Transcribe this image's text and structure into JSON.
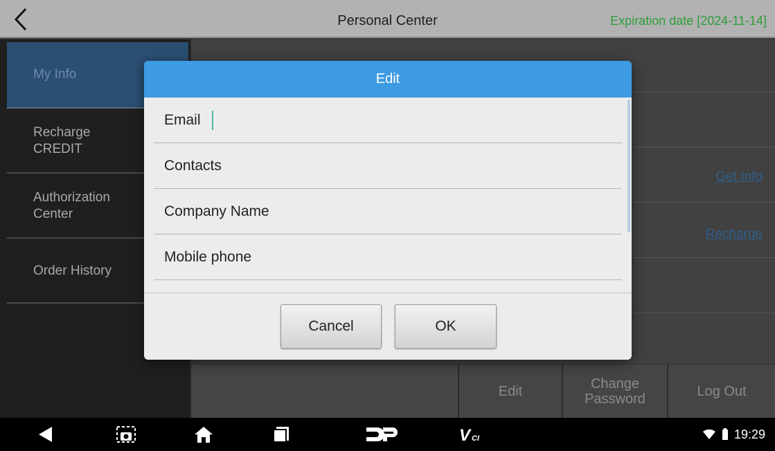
{
  "titlebar": {
    "title": "Personal Center",
    "expiry": "Expiration date [2024-11-14]"
  },
  "sidebar": {
    "items": [
      {
        "label": "My Info"
      },
      {
        "label": "Recharge\nCREDIT"
      },
      {
        "label": "Authorization\nCenter"
      },
      {
        "label": "Order History"
      }
    ]
  },
  "main": {
    "links": {
      "get_info": "Get Info",
      "recharge": "Recharge"
    }
  },
  "actions": {
    "edit": "Edit",
    "change_password": "Change\nPassword",
    "logout": "Log Out"
  },
  "dialog": {
    "title": "Edit",
    "fields": [
      {
        "label": "Email"
      },
      {
        "label": "Contacts"
      },
      {
        "label": "Company Name"
      },
      {
        "label": "Mobile phone"
      }
    ],
    "cancel": "Cancel",
    "ok": "OK"
  },
  "statusbar": {
    "time": "19:29",
    "vci_label": "V"
  },
  "colors": {
    "dialog_header": "#3d9be3",
    "expiry_text": "#2e9d3a",
    "link": "#2f5f8c"
  }
}
